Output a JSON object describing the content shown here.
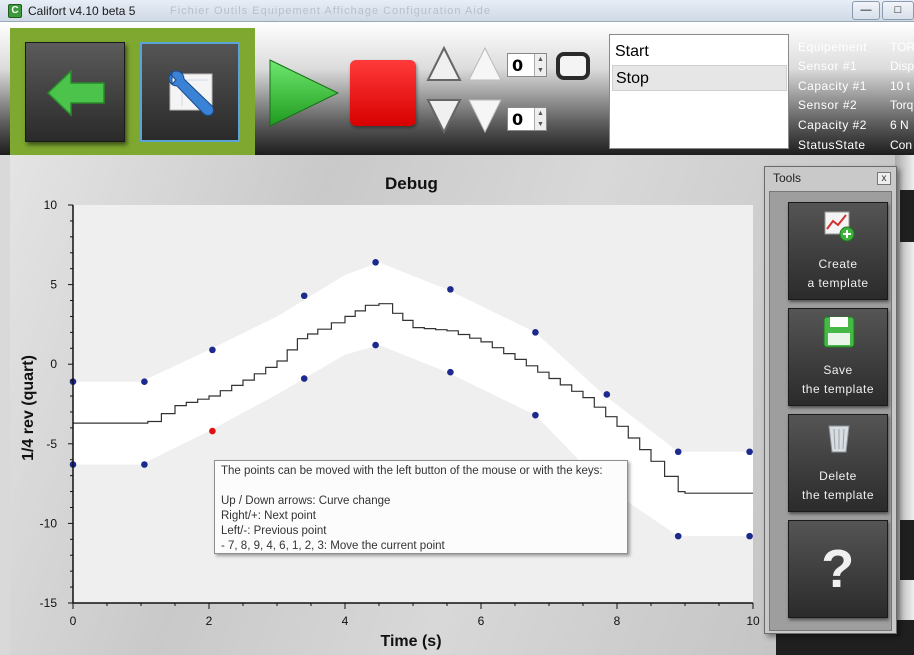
{
  "window": {
    "title": "Califort v4.10 beta 5",
    "faded_menu": "Fichier   Outils   Equipement   Affichage   Configuration   Aide"
  },
  "toolbar": {
    "spin_top_value": "0",
    "spin_bottom_value": "0",
    "list_items": [
      "Start",
      "Stop"
    ],
    "selected_list_item": "Stop",
    "info": [
      {
        "label": "Equipement",
        "value": "TOR"
      },
      {
        "label": "Sensor #1",
        "value": "Disp"
      },
      {
        "label": "Capacity #1",
        "value": "10 t"
      },
      {
        "label": "Sensor #2",
        "value": "Torq"
      },
      {
        "label": "Capacity #2",
        "value": "6 N"
      },
      {
        "label": "StatusState",
        "value": "Con"
      }
    ]
  },
  "icons": {
    "back": "back-arrow-icon",
    "settings": "wrench-settings-icon",
    "play": "play-icon",
    "stop": "stop-icon"
  },
  "colors": {
    "accent_green": "#7ea830",
    "play_green": "#2fbf2f",
    "stop_red": "#e00000",
    "point_blue": "#1b2a8c",
    "point_selected": "#e01010"
  },
  "chart_data": {
    "type": "line",
    "title": "Debug",
    "xlabel": "Time (s)",
    "ylabel": "1/4 rev (quart)",
    "xlim": [
      0,
      10
    ],
    "ylim": [
      -15,
      10
    ],
    "xticks": [
      0,
      2,
      4,
      6,
      8,
      10
    ],
    "yticks": [
      10,
      5,
      0,
      -5,
      -10,
      -15
    ],
    "grid": false,
    "curve": {
      "x": [
        0,
        1.0,
        1.1,
        1.5,
        2.0,
        2.5,
        3.0,
        3.3,
        3.6,
        4.0,
        4.3,
        4.5,
        4.7,
        5.0,
        5.5,
        6.0,
        6.5,
        7.0,
        7.5,
        8.0,
        8.5,
        8.9,
        9.0,
        10.0
      ],
      "y": [
        -3.7,
        -3.7,
        -3.6,
        -2.6,
        -2.0,
        -1.0,
        0.2,
        1.6,
        2.2,
        3.0,
        3.7,
        3.8,
        3.2,
        2.3,
        2.1,
        1.4,
        0.3,
        -0.9,
        -2.1,
        -3.9,
        -6.1,
        -8.0,
        -8.1,
        -8.1
      ]
    },
    "band_upper": {
      "x": [
        0,
        1.0,
        2.0,
        3.0,
        4.0,
        4.5,
        5.5,
        6.8,
        7.8,
        8.9,
        10.0
      ],
      "y": [
        -1.1,
        -1.1,
        0.9,
        3.0,
        5.6,
        6.4,
        4.7,
        2.0,
        -1.9,
        -5.5,
        -5.5
      ]
    },
    "band_lower": {
      "x": [
        0,
        1.0,
        2.0,
        3.0,
        4.0,
        4.5,
        5.5,
        6.8,
        7.8,
        8.9,
        10.0
      ],
      "y": [
        -6.3,
        -6.3,
        -4.2,
        -1.9,
        0.6,
        1.2,
        -0.5,
        -3.2,
        -7.6,
        -10.8,
        -10.8
      ]
    },
    "points": [
      {
        "x": 0.0,
        "y": -1.1
      },
      {
        "x": 1.05,
        "y": -1.1
      },
      {
        "x": 2.05,
        "y": 0.9
      },
      {
        "x": 3.4,
        "y": 4.3
      },
      {
        "x": 4.45,
        "y": 6.4
      },
      {
        "x": 5.55,
        "y": 4.7
      },
      {
        "x": 6.8,
        "y": 2.0
      },
      {
        "x": 7.85,
        "y": -1.9
      },
      {
        "x": 8.9,
        "y": -5.5
      },
      {
        "x": 9.95,
        "y": -5.5
      },
      {
        "x": 0.0,
        "y": -6.3
      },
      {
        "x": 1.05,
        "y": -6.3
      },
      {
        "x": 2.05,
        "y": -4.2,
        "selected": true
      },
      {
        "x": 3.4,
        "y": -0.9
      },
      {
        "x": 4.45,
        "y": 1.2
      },
      {
        "x": 5.55,
        "y": -0.5
      },
      {
        "x": 6.8,
        "y": -3.2
      },
      {
        "x": 8.9,
        "y": -10.8
      },
      {
        "x": 9.95,
        "y": -10.8
      }
    ]
  },
  "tooltip": {
    "lines": [
      "The points can be moved with the left button of the mouse or with the keys:",
      "",
      "Up / Down arrows: Curve change",
      "Right/+: Next point",
      "Left/-: Previous point",
      "- 7, 8, 9, 4, 6, 1, 2, 3: Move the current point"
    ]
  },
  "tools": {
    "title": "Tools",
    "close": "x",
    "buttons": [
      {
        "line1": "Create",
        "line2": "a template",
        "icon": "create-template-icon"
      },
      {
        "line1": "Save",
        "line2": "the template",
        "icon": "save-disk-icon"
      },
      {
        "line1": "Delete",
        "line2": "the template",
        "icon": "trash-icon"
      },
      {
        "line1": "?",
        "line2": "",
        "icon": "help-icon"
      }
    ]
  }
}
